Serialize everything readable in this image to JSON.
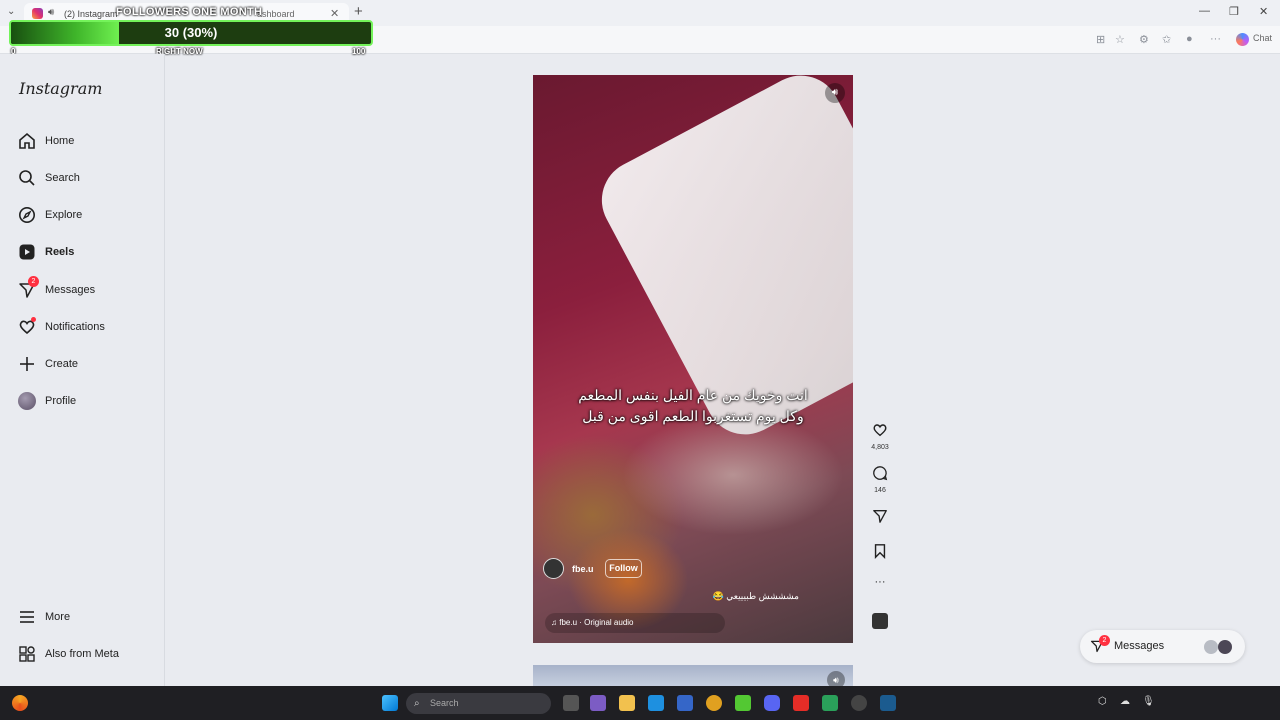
{
  "browser": {
    "tab_title": "(2) Instagram",
    "tab_title_2": "ashboard",
    "new_tab": "+",
    "chat_label": "Chat",
    "window_controls": [
      "—",
      "❐",
      "✕"
    ]
  },
  "overlay": {
    "title": "FOLLOWERS ONE MONTH",
    "progress_text": "30 (30%)",
    "progress_fraction": 0.3,
    "min_label": "0",
    "mid_label": "RIGHT NOW",
    "max_label": "100"
  },
  "sidebar": {
    "logo": "Instagram",
    "items": [
      {
        "label": "Home",
        "icon": "home-icon"
      },
      {
        "label": "Search",
        "icon": "search-icon"
      },
      {
        "label": "Explore",
        "icon": "compass-icon"
      },
      {
        "label": "Reels",
        "icon": "reels-icon",
        "active": true
      },
      {
        "label": "Messages",
        "icon": "messenger-icon",
        "badge": "2"
      },
      {
        "label": "Notifications",
        "icon": "heart-icon"
      },
      {
        "label": "Create",
        "icon": "plus-icon"
      },
      {
        "label": "Profile",
        "icon": "avatar"
      }
    ],
    "more": "More",
    "also_from_meta": "Also from Meta"
  },
  "reel": {
    "caption_line1": "انت وخويك من عام الفيل بنفس المطعم",
    "caption_line2": "وكل يوم تستغربوا الطعم اقوى من قبل",
    "author": "fbe.u",
    "follow_label": "Follow",
    "description": "مشششش طبيييعي 😂",
    "audio": "♫ fbe.u · Original audio",
    "likes": "4,803",
    "comments": "146"
  },
  "messages_pill": {
    "label": "Messages",
    "badge": "2"
  },
  "taskbar": {
    "search_placeholder": "Search"
  },
  "colors": {
    "progress_border": "#74f35a",
    "notification_red": "#ff3040"
  }
}
